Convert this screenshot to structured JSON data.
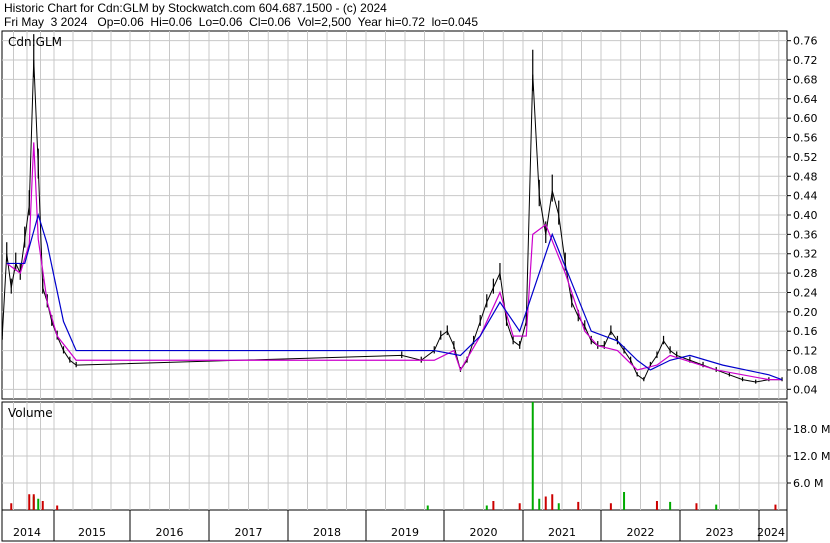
{
  "header": {
    "line1": "Historic Chart for Cdn:GLM by Stockwatch.com 604.687.1500 - (c) 2024",
    "line2": "Fri May  3 2024   Op=0.06  Hi=0.06  Lo=0.06  Cl=0.06  Vol=2,500  Year hi=0.72  lo=0.045"
  },
  "chart_data": [
    {
      "type": "line",
      "panel": "price",
      "title": "Cdn:GLM",
      "ylim": [
        0.02,
        0.78
      ],
      "y_ticks": [
        "0.76",
        "0.72",
        "0.68",
        "0.64",
        "0.60",
        "0.56",
        "0.52",
        "0.48",
        "0.44",
        "0.40",
        "0.36",
        "0.32",
        "0.28",
        "0.24",
        "0.20",
        "0.16",
        "0.12",
        "0.08",
        "0.04"
      ],
      "x_ticks": [
        "2014",
        "2015",
        "2016",
        "2017",
        "2018",
        "2019",
        "2020",
        "2021",
        "2022",
        "2023",
        "2024"
      ],
      "grid": true,
      "series": [
        {
          "kind": "price-range",
          "color": "#000000",
          "points": [
            [
              "2014-01",
              0.15
            ],
            [
              "2014-02",
              0.32
            ],
            [
              "2014-03",
              0.25
            ],
            [
              "2014-04",
              0.3
            ],
            [
              "2014-05",
              0.28
            ],
            [
              "2014-06",
              0.35
            ],
            [
              "2014-07",
              0.42
            ],
            [
              "2014-08",
              0.72
            ],
            [
              "2014-09",
              0.5
            ],
            [
              "2014-10",
              0.25
            ],
            [
              "2014-11",
              0.22
            ],
            [
              "2014-12",
              0.18
            ],
            [
              "2015-01",
              0.15
            ],
            [
              "2015-02",
              0.12
            ],
            [
              "2015-03",
              0.1
            ],
            [
              "2015-04",
              0.09
            ],
            [
              "2019-06",
              0.11
            ],
            [
              "2019-09",
              0.1
            ],
            [
              "2019-11",
              0.12
            ],
            [
              "2019-12",
              0.15
            ],
            [
              "2020-01",
              0.16
            ],
            [
              "2020-02",
              0.13
            ],
            [
              "2020-03",
              0.08
            ],
            [
              "2020-04",
              0.1
            ],
            [
              "2020-05",
              0.14
            ],
            [
              "2020-06",
              0.18
            ],
            [
              "2020-07",
              0.22
            ],
            [
              "2020-08",
              0.25
            ],
            [
              "2020-09",
              0.28
            ],
            [
              "2020-10",
              0.18
            ],
            [
              "2020-11",
              0.14
            ],
            [
              "2020-12",
              0.13
            ],
            [
              "2021-01",
              0.18
            ],
            [
              "2021-02",
              0.69
            ],
            [
              "2021-03",
              0.44
            ],
            [
              "2021-04",
              0.36
            ],
            [
              "2021-05",
              0.45
            ],
            [
              "2021-06",
              0.4
            ],
            [
              "2021-07",
              0.3
            ],
            [
              "2021-08",
              0.22
            ],
            [
              "2021-09",
              0.19
            ],
            [
              "2021-10",
              0.17
            ],
            [
              "2021-11",
              0.14
            ],
            [
              "2021-12",
              0.13
            ],
            [
              "2022-01",
              0.13
            ],
            [
              "2022-02",
              0.16
            ],
            [
              "2022-03",
              0.14
            ],
            [
              "2022-04",
              0.12
            ],
            [
              "2022-05",
              0.1
            ],
            [
              "2022-06",
              0.07
            ],
            [
              "2022-07",
              0.06
            ],
            [
              "2022-08",
              0.09
            ],
            [
              "2022-09",
              0.11
            ],
            [
              "2022-10",
              0.14
            ],
            [
              "2022-11",
              0.12
            ],
            [
              "2022-12",
              0.11
            ],
            [
              "2023-02",
              0.1
            ],
            [
              "2023-04",
              0.09
            ],
            [
              "2023-06",
              0.08
            ],
            [
              "2023-08",
              0.07
            ],
            [
              "2023-10",
              0.06
            ],
            [
              "2023-12",
              0.055
            ],
            [
              "2024-02",
              0.06
            ],
            [
              "2024-04",
              0.06
            ]
          ]
        },
        {
          "kind": "moving-average",
          "color": "#cc00cc",
          "points": [
            [
              "2014-02",
              0.3
            ],
            [
              "2014-05",
              0.28
            ],
            [
              "2014-07",
              0.34
            ],
            [
              "2014-08",
              0.55
            ],
            [
              "2014-09",
              0.35
            ],
            [
              "2014-11",
              0.22
            ],
            [
              "2015-01",
              0.15
            ],
            [
              "2015-04",
              0.1
            ],
            [
              "2019-11",
              0.1
            ],
            [
              "2020-02",
              0.12
            ],
            [
              "2020-03",
              0.08
            ],
            [
              "2020-06",
              0.15
            ],
            [
              "2020-09",
              0.24
            ],
            [
              "2020-11",
              0.15
            ],
            [
              "2021-01",
              0.15
            ],
            [
              "2021-02",
              0.36
            ],
            [
              "2021-04",
              0.38
            ],
            [
              "2021-07",
              0.28
            ],
            [
              "2021-10",
              0.16
            ],
            [
              "2021-12",
              0.13
            ],
            [
              "2022-03",
              0.12
            ],
            [
              "2022-06",
              0.08
            ],
            [
              "2022-09",
              0.09
            ],
            [
              "2022-11",
              0.11
            ],
            [
              "2023-06",
              0.08
            ],
            [
              "2024-02",
              0.06
            ],
            [
              "2024-04",
              0.06
            ]
          ]
        },
        {
          "kind": "moving-average",
          "color": "#0000cc",
          "points": [
            [
              "2014-02",
              0.3
            ],
            [
              "2014-06",
              0.3
            ],
            [
              "2014-09",
              0.4
            ],
            [
              "2014-11",
              0.34
            ],
            [
              "2015-02",
              0.18
            ],
            [
              "2015-04",
              0.12
            ],
            [
              "2019-11",
              0.12
            ],
            [
              "2020-03",
              0.11
            ],
            [
              "2020-06",
              0.15
            ],
            [
              "2020-09",
              0.22
            ],
            [
              "2020-12",
              0.16
            ],
            [
              "2021-03",
              0.28
            ],
            [
              "2021-05",
              0.36
            ],
            [
              "2021-08",
              0.26
            ],
            [
              "2021-11",
              0.16
            ],
            [
              "2022-03",
              0.14
            ],
            [
              "2022-06",
              0.1
            ],
            [
              "2022-08",
              0.08
            ],
            [
              "2022-11",
              0.1
            ],
            [
              "2023-02",
              0.11
            ],
            [
              "2023-07",
              0.09
            ],
            [
              "2024-02",
              0.07
            ],
            [
              "2024-04",
              0.06
            ]
          ]
        }
      ]
    },
    {
      "type": "bar",
      "panel": "volume",
      "ylabel": "Volume",
      "y_ticks": [
        "18.0 M",
        "12.0 M",
        "6.0 M"
      ],
      "ylim_millions": [
        0,
        24
      ],
      "grid": true,
      "series": [
        {
          "name": "up",
          "color": "#00aa00",
          "points": [
            [
              "2014-08",
              3.0
            ],
            [
              "2014-09",
              2.5
            ],
            [
              "2019-10",
              1.0
            ],
            [
              "2020-07",
              1.0
            ],
            [
              "2021-02",
              24.0
            ],
            [
              "2021-03",
              2.5
            ],
            [
              "2021-06",
              1.5
            ],
            [
              "2022-04",
              4.0
            ],
            [
              "2022-11",
              1.8
            ],
            [
              "2023-06",
              1.2
            ]
          ]
        },
        {
          "name": "down",
          "color": "#cc0000",
          "points": [
            [
              "2014-03",
              1.5
            ],
            [
              "2014-07",
              3.5
            ],
            [
              "2014-08",
              3.5
            ],
            [
              "2014-10",
              2.0
            ],
            [
              "2015-01",
              1.0
            ],
            [
              "2020-08",
              2.0
            ],
            [
              "2020-12",
              1.5
            ],
            [
              "2021-04",
              3.0
            ],
            [
              "2021-05",
              3.5
            ],
            [
              "2021-09",
              1.8
            ],
            [
              "2022-02",
              1.5
            ],
            [
              "2022-09",
              2.0
            ],
            [
              "2023-03",
              1.5
            ],
            [
              "2024-03",
              1.2
            ]
          ]
        }
      ]
    }
  ]
}
